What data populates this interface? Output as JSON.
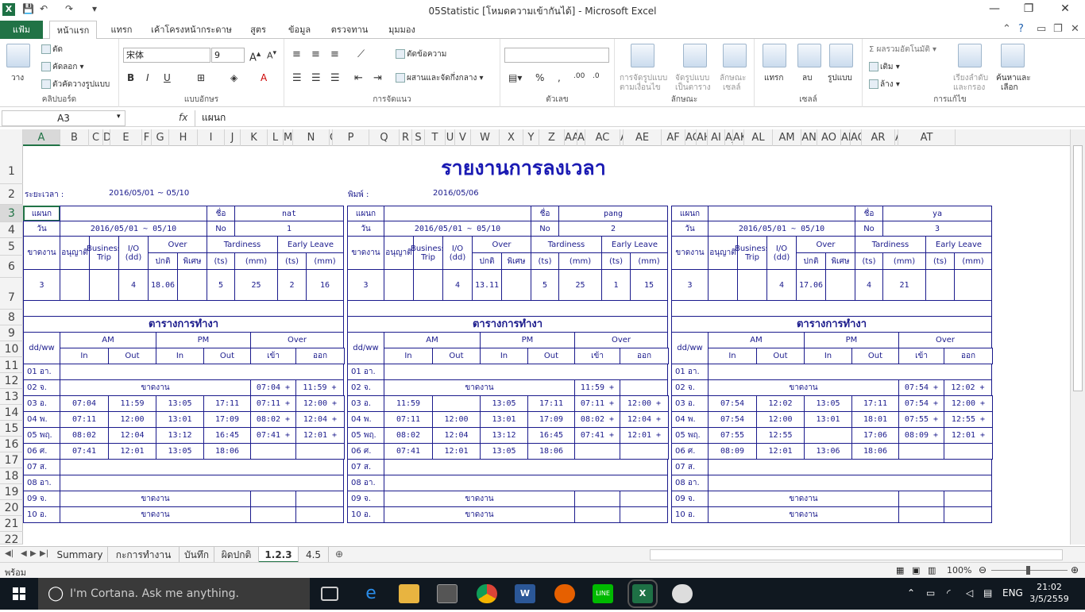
{
  "window": {
    "title": "05Statistic  [โหมดความเข้ากันได้] - Microsoft Excel",
    "app_icon": "X",
    "qat_customize": "▾"
  },
  "ribbon_tabs": {
    "file": "แฟ้ม",
    "tabs": [
      "หน้าแรก",
      "แทรก",
      "เค้าโครงหน้ากระดาษ",
      "สูตร",
      "ข้อมูล",
      "ตรวจทาน",
      "มุมมอง"
    ]
  },
  "ribbon": {
    "clipboard": {
      "group": "คลิปบอร์ด",
      "paste": "วาง",
      "cut": "ตัด",
      "copy": "คัดลอก",
      "format_painter": "ตัวคัดวางรูปแบบ"
    },
    "font": {
      "group": "แบบอักษร",
      "name": "宋体",
      "size": "9"
    },
    "alignment": {
      "group": "การจัดแนว",
      "wrap": "ตัดข้อความ",
      "merge": "ผสานและจัดกึ่งกลาง"
    },
    "number": {
      "group": "ตัวเลข"
    },
    "styles": {
      "group": "ลักษณะ",
      "cond1": "การจัดรูปแบบ",
      "cond2": "ตามเงื่อนไข",
      "table1": "จัดรูปแบบ",
      "table2": "เป็นตาราง",
      "cell1": "ลักษณะ",
      "cell2": "เซลล์"
    },
    "cells": {
      "group": "เซลล์",
      "insert": "แทรก",
      "delete": "ลบ",
      "format": "รูปแบบ"
    },
    "editing": {
      "group": "การแก้ไข",
      "autosum": "ผลรวมอัตโนมัติ",
      "fill": "เติม",
      "clear": "ล้าง",
      "sort1": "เรียงลำดับ",
      "sort2": "และกรอง",
      "find1": "ค้นหาและ",
      "find2": "เลือก"
    }
  },
  "formula_bar": {
    "name_box": "A3",
    "fx": "fx",
    "value": "แผนก"
  },
  "columns": [
    "A",
    "B",
    "C",
    "D",
    "E",
    "F",
    "G",
    "H",
    "I",
    "J",
    "K",
    "L",
    "M",
    "N",
    "O",
    "P",
    "Q",
    "R",
    "S",
    "T",
    "U",
    "V",
    "W",
    "X",
    "Y",
    "Z",
    "AA",
    "AB",
    "AC",
    "AD",
    "AE",
    "AF",
    "AG",
    "AH",
    "AI",
    "AJ",
    "AK",
    "AL",
    "AM",
    "AN",
    "AO",
    "AP",
    "AQ",
    "AR",
    "AS",
    "AT"
  ],
  "rows": [
    "1",
    "2",
    "3",
    "4",
    "5",
    "6",
    "7",
    "8",
    "9",
    "10",
    "11",
    "12",
    "13",
    "14",
    "15",
    "16",
    "17",
    "18",
    "19",
    "20",
    "21",
    "22"
  ],
  "report": {
    "title": "รายงานการลงเวลา",
    "period_label": "ระยะเวลา :",
    "period_value": "2016/05/01 ~ 05/10",
    "print_label": "พิมพ์ :",
    "print_value": "2016/05/06"
  },
  "labels": {
    "dept": "แผนก",
    "name": "ชื่อ",
    "date": "วัน",
    "no": "No",
    "absent": "ขาดงาน",
    "leave": "อนุญาติ",
    "biz": "Business Trip",
    "io": "I/O (dd)",
    "over": "Over",
    "tardiness": "Tardiness",
    "early": "Early Leave",
    "normal": "ปกติ",
    "special": "พิเศษ",
    "ts": "(ts)",
    "mm": "(mm)",
    "schedule": "ตารางการทำงา",
    "ddww": "dd/ww",
    "am": "AM",
    "pm": "PM",
    "in": "In",
    "out": "Out",
    "enter": "เข้า",
    "exit": "ออก",
    "absent_day": "ขาดงาน"
  },
  "cards": [
    {
      "name": "nat",
      "date": "2016/05/01 ~ 05/10",
      "no": "1",
      "summary": [
        "3",
        "",
        "",
        "4",
        "18.06",
        "",
        "5",
        "25",
        "2",
        "16"
      ],
      "days": [
        [
          "01 อา.",
          "",
          "",
          "",
          "",
          "",
          ""
        ],
        [
          "02 จ.",
          "ABSENT",
          "",
          "",
          "",
          "07:04 +",
          "11:59 +"
        ],
        [
          "03 อ.",
          "07:04",
          "11:59",
          "13:05",
          "17:11",
          "07:11 +",
          "12:00 +"
        ],
        [
          "04 พ.",
          "07:11",
          "12:00",
          "13:01",
          "17:09",
          "08:02 +",
          "12:04 +"
        ],
        [
          "05 พฤ.",
          "08:02",
          "12:04",
          "13:12",
          "16:45",
          "07:41 +",
          "12:01 +"
        ],
        [
          "06 ศ.",
          "07:41",
          "12:01",
          "13:05",
          "18:06",
          "",
          ""
        ],
        [
          "07 ส.",
          "",
          "",
          "",
          "",
          "",
          ""
        ],
        [
          "08 อา.",
          "",
          "",
          "",
          "",
          "",
          ""
        ],
        [
          "09 จ.",
          "ABSENT",
          "",
          "",
          "",
          "",
          ""
        ],
        [
          "10 อ.",
          "ABSENT",
          "",
          "",
          "",
          "",
          ""
        ]
      ]
    },
    {
      "name": "pang",
      "date": "2016/05/01 ~ 05/10",
      "no": "2",
      "summary": [
        "3",
        "",
        "",
        "4",
        "13.11",
        "",
        "5",
        "25",
        "1",
        "15"
      ],
      "days": [
        [
          "01 อา.",
          "",
          "",
          "",
          "",
          "",
          ""
        ],
        [
          "02 จ.",
          "ABSENT",
          "",
          "",
          "",
          "11:59 +",
          ""
        ],
        [
          "03 อ.",
          "11:59",
          "",
          "13:05",
          "17:11",
          "07:11 +",
          "12:00 +"
        ],
        [
          "04 พ.",
          "07:11",
          "12:00",
          "13:01",
          "17:09",
          "08:02 +",
          "12:04 +"
        ],
        [
          "05 พฤ.",
          "08:02",
          "12:04",
          "13:12",
          "16:45",
          "07:41 +",
          "12:01 +"
        ],
        [
          "06 ศ.",
          "07:41",
          "12:01",
          "13:05",
          "18:06",
          "",
          ""
        ],
        [
          "07 ส.",
          "",
          "",
          "",
          "",
          "",
          ""
        ],
        [
          "08 อา.",
          "",
          "",
          "",
          "",
          "",
          ""
        ],
        [
          "09 จ.",
          "ABSENT",
          "",
          "",
          "",
          "",
          ""
        ],
        [
          "10 อ.",
          "ABSENT",
          "",
          "",
          "",
          "",
          ""
        ]
      ]
    },
    {
      "name": "ya",
      "date": "2016/05/01 ~ 05/10",
      "no": "3",
      "summary": [
        "3",
        "",
        "",
        "4",
        "17.06",
        "",
        "4",
        "21",
        "",
        ""
      ],
      "days": [
        [
          "01 อา.",
          "",
          "",
          "",
          "",
          "",
          ""
        ],
        [
          "02 จ.",
          "ABSENT",
          "",
          "",
          "",
          "07:54 +",
          "12:02 +"
        ],
        [
          "03 อ.",
          "07:54",
          "12:02",
          "13:05",
          "17:11",
          "07:54 +",
          "12:00 +"
        ],
        [
          "04 พ.",
          "07:54",
          "12:00",
          "13:01",
          "18:01",
          "07:55 +",
          "12:55 +"
        ],
        [
          "05 พฤ.",
          "07:55",
          "12:55",
          "",
          "17:06",
          "08:09 +",
          "12:01 +"
        ],
        [
          "06 ศ.",
          "08:09",
          "12:01",
          "13:06",
          "18:06",
          "",
          ""
        ],
        [
          "07 ส.",
          "",
          "",
          "",
          "",
          "",
          ""
        ],
        [
          "08 อา.",
          "",
          "",
          "",
          "",
          "",
          ""
        ],
        [
          "09 จ.",
          "ABSENT",
          "",
          "",
          "",
          "",
          ""
        ],
        [
          "10 อ.",
          "ABSENT",
          "",
          "",
          "",
          "",
          ""
        ]
      ]
    }
  ],
  "sheet_tabs": [
    "Summary",
    "กะการทำงาน",
    "บันทึก",
    "ผิดปกติ",
    "1.2.3",
    "4.5"
  ],
  "active_sheet": "1.2.3",
  "status": {
    "ready": "พร้อม",
    "zoom": "100%"
  },
  "taskbar": {
    "cortana": "I'm Cortana. Ask me anything.",
    "lang": "ENG",
    "time": "21:02",
    "date": "3/5/2559"
  },
  "colors": {
    "excel_green": "#217346",
    "report_blue": "#1a1a8c",
    "title_blue": "#1a1ab3"
  }
}
